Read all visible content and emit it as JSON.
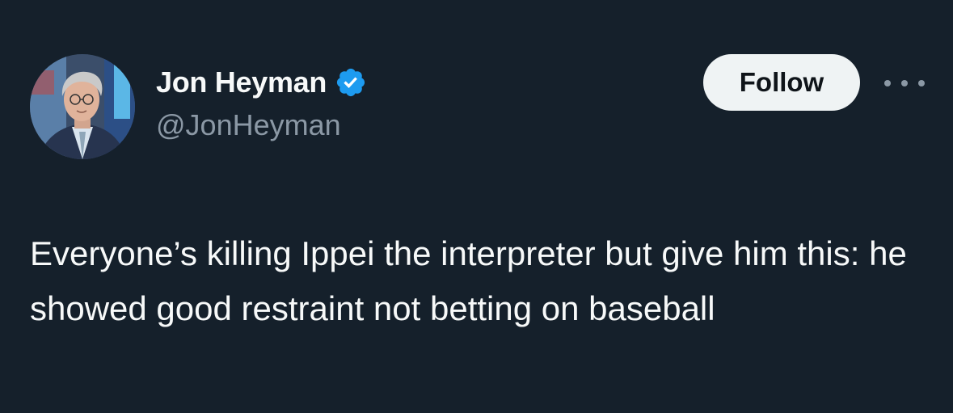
{
  "author": {
    "display_name": "Jon Heyman",
    "handle": "@JonHeyman",
    "verified": true,
    "avatar_icon": "profile-photo"
  },
  "actions": {
    "follow_label": "Follow",
    "more_icon": "more-horizontal-icon"
  },
  "tweet": {
    "text": "Everyone’s killing Ippei the interpreter but give him this: he showed good restraint not betting on baseball"
  },
  "colors": {
    "background": "#15202b",
    "text_primary": "#f7f9f9",
    "text_secondary": "#8b98a5",
    "verified_badge": "#1d9bf0",
    "follow_button_bg": "#eff3f4",
    "follow_button_text": "#0f1419"
  }
}
